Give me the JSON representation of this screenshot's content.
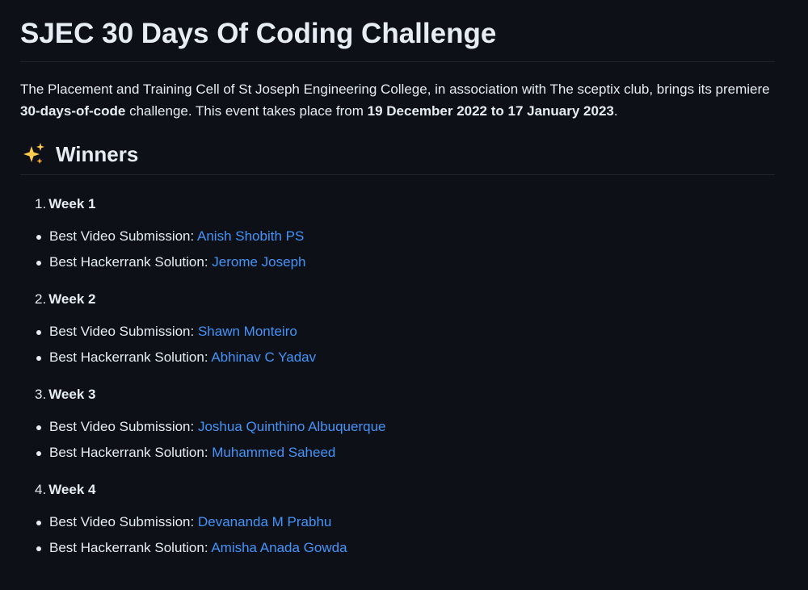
{
  "title": "SJEC 30 Days Of Coding Challenge",
  "intro": {
    "part1": "The Placement and Training Cell of St Joseph Engineering College, in association with The sceptix club, brings its premiere ",
    "bold1": "30-days-of-code",
    "part2": " challenge. This event takes place from ",
    "bold2": "19 December 2022 to 17 January 2023",
    "part3": "."
  },
  "winners_heading": "Winners",
  "icons": {
    "sparkles": "sparkles-icon"
  },
  "colors": {
    "link": "#4493f8",
    "background": "#0d1117",
    "text": "#e6edf3"
  },
  "weeks": [
    {
      "num": "1.",
      "label": "Week 1",
      "awards": [
        {
          "category": "Best Video Submission: ",
          "winner": "Anish Shobith PS"
        },
        {
          "category": "Best Hackerrank Solution: ",
          "winner": "Jerome Joseph"
        }
      ]
    },
    {
      "num": "2.",
      "label": "Week 2",
      "awards": [
        {
          "category": "Best Video Submission: ",
          "winner": "Shawn Monteiro"
        },
        {
          "category": "Best Hackerrank Solution: ",
          "winner": "Abhinav C Yadav"
        }
      ]
    },
    {
      "num": "3.",
      "label": "Week 3",
      "awards": [
        {
          "category": "Best Video Submission: ",
          "winner": "Joshua Quinthino Albuquerque"
        },
        {
          "category": "Best Hackerrank Solution: ",
          "winner": "Muhammed Saheed"
        }
      ]
    },
    {
      "num": "4.",
      "label": "Week 4",
      "awards": [
        {
          "category": "Best Video Submission: ",
          "winner": "Devananda M Prabhu"
        },
        {
          "category": "Best Hackerrank Solution: ",
          "winner": "Amisha Anada Gowda"
        }
      ]
    }
  ]
}
